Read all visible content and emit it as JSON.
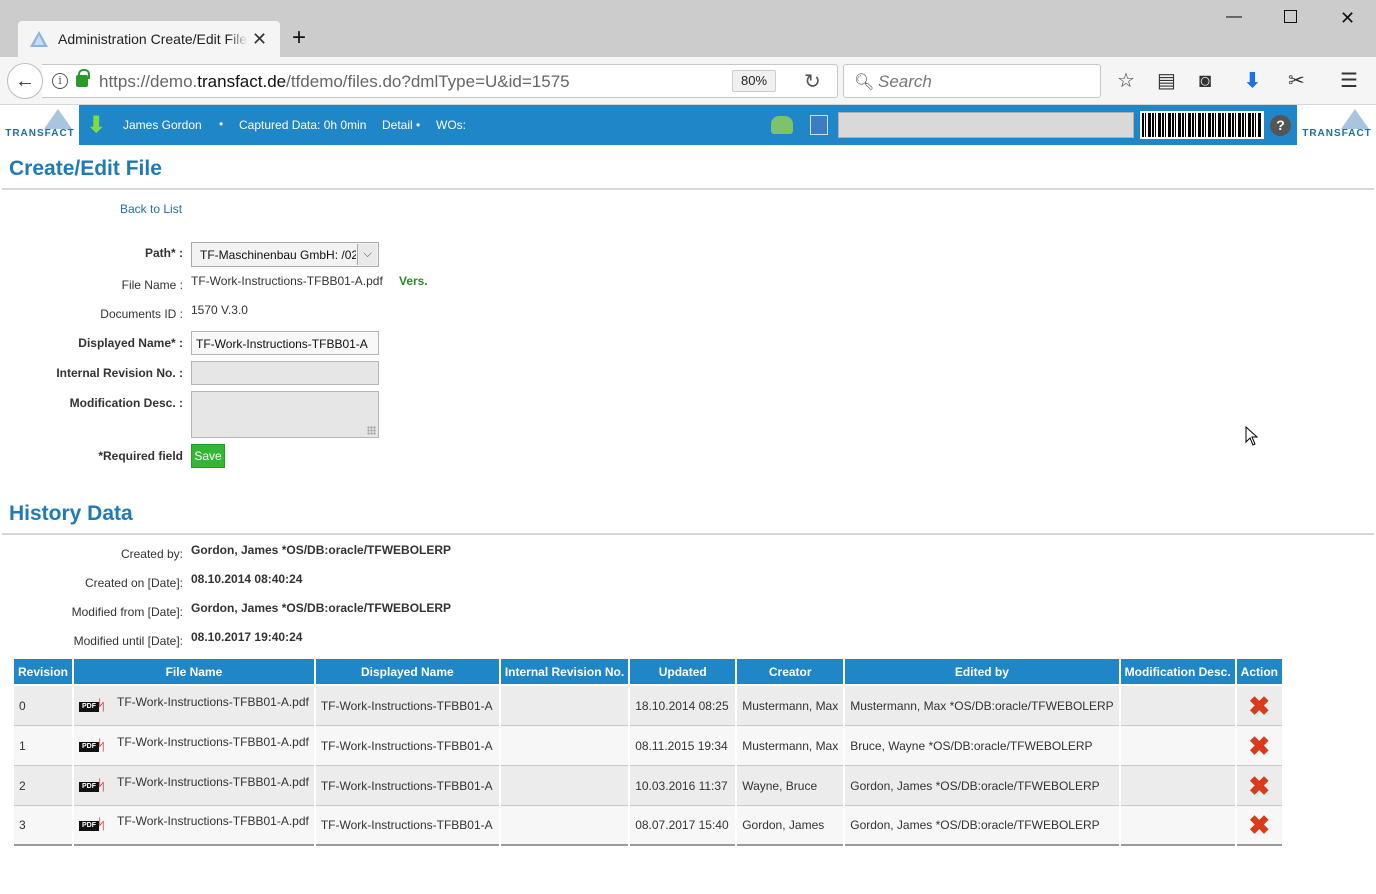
{
  "browser": {
    "tab_title": "Administration Create/Edit File",
    "url_prefix": "https://demo.",
    "url_domain": "transfact.de",
    "url_path": "/tfdemo/files.do?dmlType=U&id=1575",
    "zoom": "80%",
    "search_placeholder": "Search"
  },
  "app_header": {
    "logo_text": "TRANSFACT",
    "user": "James Gordon",
    "captured": "Captured Data: 0h 0min",
    "detail": "Detail",
    "wos": "WOs:"
  },
  "form": {
    "title": "Create/Edit File",
    "back_link": "Back to List",
    "path_label": "Path* :",
    "path_value": "TF-Maschinenbau GmbH: /02",
    "file_name_label": "File Name :",
    "file_name_value": "TF-Work-Instructions-TFBB01-A.pdf",
    "vers_label": "Vers.",
    "doc_id_label": "Documents ID :",
    "doc_id_value": "1570 V.3.0",
    "displayed_name_label": "Displayed Name* :",
    "displayed_name_value": "TF-Work-Instructions-TFBB01-A",
    "internal_rev_label": "Internal Revision No. :",
    "internal_rev_value": "",
    "mod_desc_label": "Modification Desc. :",
    "required_note": "*Required field",
    "save_label": "Save"
  },
  "history": {
    "title": "History Data",
    "created_by_label": "Created by:",
    "created_by_value": "Gordon, James *OS/DB:oracle/TFWEBOLERP",
    "created_on_label": "Created on [Date]:",
    "created_on_value": "08.10.2014 08:40:24",
    "modified_from_label": "Modified from [Date]:",
    "modified_from_value": "Gordon, James *OS/DB:oracle/TFWEBOLERP",
    "modified_until_label": "Modified until [Date]:",
    "modified_until_value": "08.10.2017 19:40:24",
    "columns": [
      "Revision",
      "File Name",
      "Displayed Name",
      "Internal Revision No.",
      "Updated",
      "Creator",
      "Edited by",
      "Modification Desc.",
      "Action"
    ],
    "rows": [
      {
        "revision": "0",
        "file_name": "TF-Work-Instructions-TFBB01-A.pdf",
        "displayed_name": "TF-Work-Instructions-TFBB01-A",
        "internal_rev": "",
        "updated": "18.10.2014 08:25",
        "creator": "Mustermann, Max",
        "edited_by": "Mustermann, Max *OS/DB:oracle/TFWEBOLERP",
        "mod_desc": ""
      },
      {
        "revision": "1",
        "file_name": "TF-Work-Instructions-TFBB01-A.pdf",
        "displayed_name": "TF-Work-Instructions-TFBB01-A",
        "internal_rev": "",
        "updated": "08.11.2015 19:34",
        "creator": "Mustermann, Max",
        "edited_by": "Bruce, Wayne *OS/DB:oracle/TFWEBOLERP",
        "mod_desc": ""
      },
      {
        "revision": "2",
        "file_name": "TF-Work-Instructions-TFBB01-A.pdf",
        "displayed_name": "TF-Work-Instructions-TFBB01-A",
        "internal_rev": "",
        "updated": "10.03.2016 11:37",
        "creator": "Wayne, Bruce",
        "edited_by": "Gordon, James *OS/DB:oracle/TFWEBOLERP",
        "mod_desc": ""
      },
      {
        "revision": "3",
        "file_name": "TF-Work-Instructions-TFBB01-A.pdf",
        "displayed_name": "TF-Work-Instructions-TFBB01-A",
        "internal_rev": "",
        "updated": "08.07.2017 15:40",
        "creator": "Gordon, James",
        "edited_by": "Gordon, James *OS/DB:oracle/TFWEBOLERP",
        "mod_desc": ""
      }
    ]
  },
  "icons": {
    "pdf_tag": "PDF",
    "delete": "delete-icon"
  },
  "colors": {
    "accent": "#1f86c7",
    "heading": "#1f7bb6",
    "save": "#33b833",
    "delete": "#d83a1a",
    "vers": "#2a8a2a"
  }
}
